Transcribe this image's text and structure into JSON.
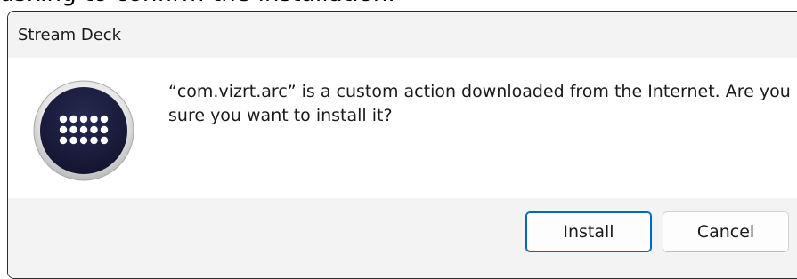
{
  "backdrop": {
    "caption": "asking to confirm the installation."
  },
  "dialog": {
    "title": "Stream Deck",
    "message": "“com.vizrt.arc” is a custom action downloaded from the Internet. Are you sure you want to install it?",
    "icon": "stream-deck-app-icon",
    "buttons": {
      "install_label": "Install",
      "cancel_label": "Cancel"
    }
  },
  "colors": {
    "titlebar_bg": "#f3f3f3",
    "footer_bg": "#f3f3f3",
    "accent_border": "#0067c0",
    "icon_bg": "#1b1d3f"
  }
}
